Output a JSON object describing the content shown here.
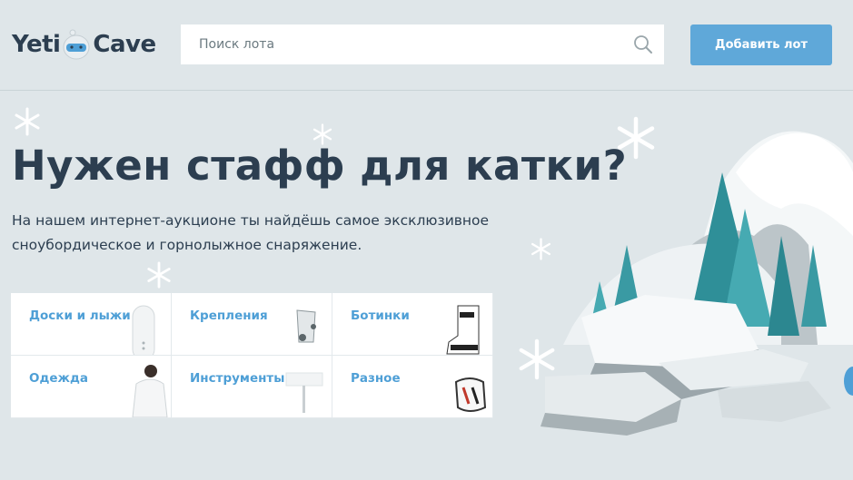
{
  "header": {
    "logo_left": "Yeti",
    "logo_right": "Cave",
    "search_placeholder": "Поиск лота",
    "add_button": "Добавить лот"
  },
  "promo": {
    "title": "Нужен стафф для катки?",
    "text": "На нашем интернет-аукционе ты найдёшь самое эксклюзивное сноубордическое и горнолыжное снаряжение."
  },
  "categories": [
    {
      "label": "Доски и лыжи",
      "icon": "snowboard-icon"
    },
    {
      "label": "Крепления",
      "icon": "binding-icon"
    },
    {
      "label": "Ботинки",
      "icon": "boot-icon"
    },
    {
      "label": "Одежда",
      "icon": "jacket-icon"
    },
    {
      "label": "Инструменты",
      "icon": "tool-icon"
    },
    {
      "label": "Разное",
      "icon": "goggles-icon"
    }
  ],
  "colors": {
    "background": "#dfe6e9",
    "accent": "#5fa8d9",
    "link": "#4e9fd6",
    "text": "#2c3e50"
  }
}
